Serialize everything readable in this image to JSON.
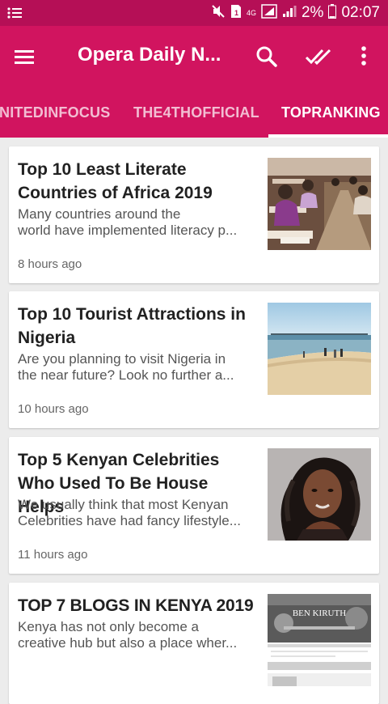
{
  "status_bar": {
    "notification_icon": "list-icon",
    "network_label": "4G",
    "battery_percent": "2%",
    "time": "02:07"
  },
  "app_bar": {
    "title": "Opera Daily N..."
  },
  "tabs": [
    {
      "label": "NITEDINFOCUS",
      "active": false
    },
    {
      "label": "THE4THOFFICIAL",
      "active": false
    },
    {
      "label": "TOPRANKING",
      "active": true
    }
  ],
  "articles": [
    {
      "title": "Top 10 Least Literate Countries of Africa 2019",
      "desc_line1": "Many countries around the",
      "desc_line2": "world have implemented literacy p...",
      "time": "8 hours ago",
      "image": "classroom-exam-photo"
    },
    {
      "title": "Top 10 Tourist Attractions in Nigeria",
      "desc_line1": "Are you planning to visit Nigeria in",
      "desc_line2": "the near future? Look no further a...",
      "time": "10 hours ago",
      "image": "beach-photo"
    },
    {
      "title": "Top 5 Kenyan Celebrities Who Used To Be House Helps",
      "desc_line1": "We usually think that most Kenyan",
      "desc_line2": "Celebrities have had fancy lifestyle...",
      "time": "11 hours ago",
      "image": "woman-portrait-photo"
    },
    {
      "title": "TOP 7 BLOGS IN KENYA 2019",
      "desc_line1": "Kenya has not only become a",
      "desc_line2": "creative hub but also a place wher...",
      "image": "blog-screenshot",
      "image_text": "BEN KIRUTH"
    }
  ],
  "colors": {
    "primary": "#d1145f",
    "status_bar": "#b50f56"
  }
}
